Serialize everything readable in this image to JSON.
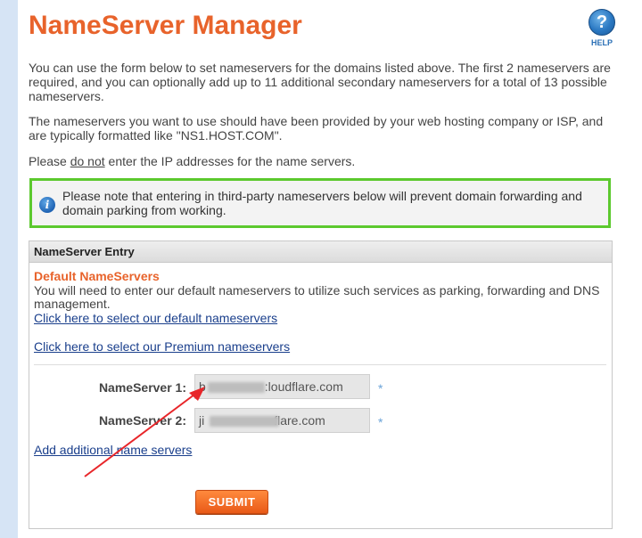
{
  "page": {
    "title": "NameServer Manager",
    "help_label": "HELP",
    "help_glyph": "?"
  },
  "intro": {
    "p1": "You can use the form below to set nameservers for the domains listed above. The first 2 nameservers are required, and you can optionally add up to 11 additional secondary nameservers for a total of 13 possible nameservers.",
    "p2": "The nameservers you want to use should have been provided by your web hosting company or ISP, and are typically formatted like \"NS1.HOST.COM\".",
    "p3_before": "Please ",
    "p3_emph": "do not",
    "p3_after": " enter the IP addresses for the name servers."
  },
  "notice": {
    "icon": "info-icon",
    "text": "Please note that entering in third-party nameservers below will prevent domain forwarding and domain parking from working.",
    "border_color": "#5cc92e"
  },
  "panel": {
    "header": "NameServer Entry",
    "default_title": "Default NameServers",
    "default_desc": "You will need to enter our default nameservers to utilize such services as parking, forwarding and DNS management.",
    "link_default": "Click here to select our default nameservers",
    "link_premium": "Click here to select our Premium nameservers",
    "ns1_label": "NameServer 1:",
    "ns1_prefix": "b",
    "ns1_suffix": ":loudflare.com",
    "ns2_label": "NameServer 2:",
    "ns2_prefix": "ji",
    "ns2_suffix": "flare.com",
    "required_mark": "*",
    "add_link": "Add additional name servers",
    "submit_label": "SUBMIT"
  },
  "colors": {
    "title": "#e8632b",
    "link": "#1a3f8c",
    "submit": "#ee6a22",
    "annotation_arrow": "#e8262a"
  }
}
